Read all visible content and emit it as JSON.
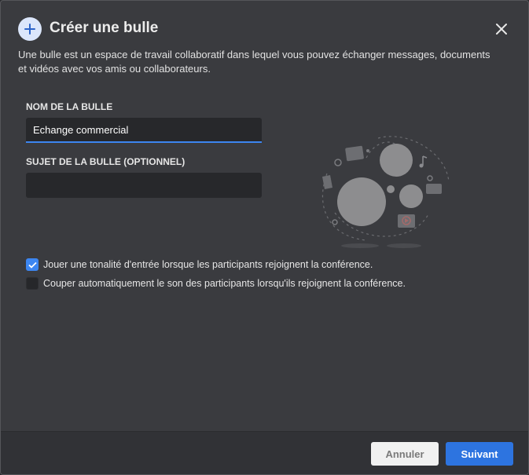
{
  "dialog": {
    "title": "Créer une bulle",
    "description": "Une bulle est un espace de travail collaboratif dans lequel vous pouvez échanger messages, documents et vidéos avec vos amis ou collaborateurs.",
    "header_icon": "plus-icon",
    "close_icon": "close-icon"
  },
  "form": {
    "name_label": "NOM DE LA BULLE",
    "name_value": "Echange commercial",
    "subject_label": "SUJET DE LA BULLE (OPTIONNEL)",
    "subject_value": ""
  },
  "options": [
    {
      "label": "Jouer une tonalité d'entrée lorsque les participants rejoignent la conférence.",
      "checked": true
    },
    {
      "label": "Couper automatiquement le son des participants lorsqu'ils rejoignent la conférence.",
      "checked": false
    }
  ],
  "footer": {
    "cancel_label": "Annuler",
    "next_label": "Suivant"
  },
  "colors": {
    "accent": "#2d74e0",
    "dialog_bg": "#3a3b3f",
    "input_bg": "#27282b"
  }
}
